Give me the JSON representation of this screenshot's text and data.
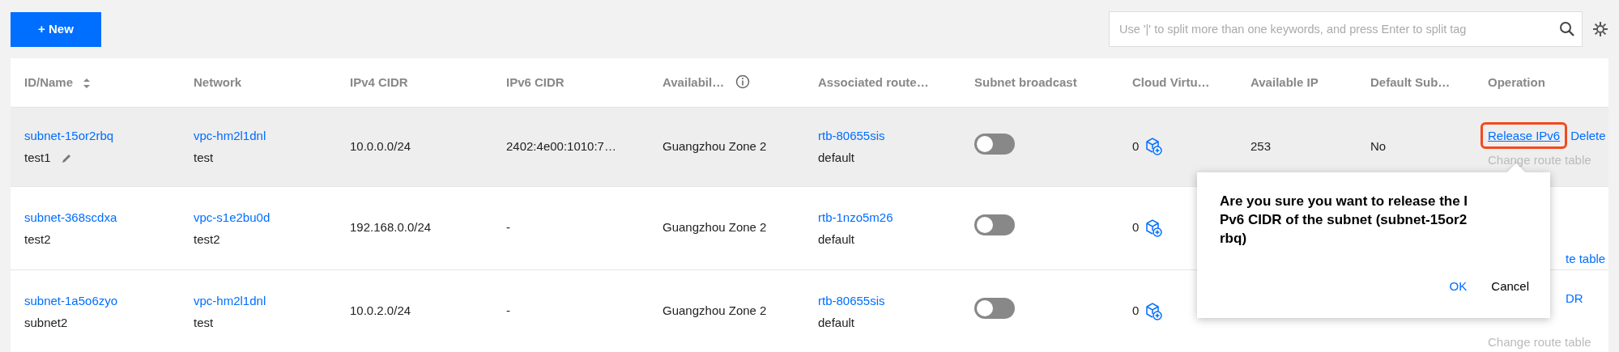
{
  "toolbar": {
    "new_button": "+ New",
    "search": {
      "placeholder": "Use '|' to split more than one keywords, and press Enter to split tag"
    }
  },
  "table": {
    "columns": [
      {
        "label": "ID/Name",
        "sortable": true,
        "info": false
      },
      {
        "label": "Network",
        "sortable": false,
        "info": false
      },
      {
        "label": "IPv4 CIDR",
        "sortable": false,
        "info": false
      },
      {
        "label": "IPv6 CIDR",
        "sortable": false,
        "info": false
      },
      {
        "label": "Availabil…",
        "sortable": false,
        "info": true
      },
      {
        "label": "Associated route…",
        "sortable": false,
        "info": false
      },
      {
        "label": "Subnet broadcast",
        "sortable": false,
        "info": false
      },
      {
        "label": "Cloud Virtu…",
        "sortable": false,
        "info": false
      },
      {
        "label": "Available IP",
        "sortable": false,
        "info": false
      },
      {
        "label": "Default Sub…",
        "sortable": false,
        "info": false
      },
      {
        "label": "Operation",
        "sortable": false,
        "info": false
      }
    ],
    "rows": [
      {
        "selected": true,
        "id": "subnet-15or2rbq",
        "name": "test1",
        "editable": true,
        "network_id": "vpc-hm2l1dnl",
        "network_name": "test",
        "ipv4": "10.0.0.0/24",
        "ipv6": "2402:4e00:1010:7…",
        "zone": "Guangzhou Zone 2",
        "route_table": "rtb-80655sis",
        "route_name": "default",
        "broadcast": false,
        "cvm_count": "0",
        "available_ip": "253",
        "default_subnet": "No",
        "operations": [
          [
            {
              "label": "Release IPv6",
              "kind": "link",
              "highlighted": true
            },
            {
              "label": "Delete",
              "kind": "link",
              "highlighted": false
            }
          ],
          [
            {
              "label": "Change route table",
              "kind": "disabled",
              "highlighted": false
            }
          ]
        ]
      },
      {
        "selected": false,
        "id": "subnet-368scdxa",
        "name": "test2",
        "editable": false,
        "network_id": "vpc-s1e2bu0d",
        "network_name": "test2",
        "ipv4": "192.168.0.0/24",
        "ipv6": "-",
        "zone": "Guangzhou Zone 2",
        "route_table": "rtb-1nzo5m26",
        "route_name": "default",
        "broadcast": false,
        "cvm_count": "0",
        "operations": [
          [
            {
              "kind": "covered"
            }
          ],
          [
            {
              "kind": "covered"
            }
          ],
          [
            {
              "label": "te table",
              "kind": "partial",
              "highlighted": false
            }
          ]
        ]
      },
      {
        "selected": false,
        "id": "subnet-1a5o6zyo",
        "name": "subnet2",
        "editable": false,
        "network_id": "vpc-hm2l1dnl",
        "network_name": "test",
        "ipv4": "10.0.2.0/24",
        "ipv6": "-",
        "zone": "Guangzhou Zone 2",
        "route_table": "rtb-80655sis",
        "route_name": "default",
        "broadcast": false,
        "cvm_count": "0",
        "operations": [
          [
            {
              "label": "DR",
              "kind": "partial",
              "highlighted": false
            }
          ],
          [
            {
              "kind": "covered"
            }
          ],
          [
            {
              "label": "Change route table",
              "kind": "disabled",
              "highlighted": false
            }
          ]
        ]
      }
    ]
  },
  "popconfirm": {
    "message": "Are you sure you want to release the IPv6 CIDR of the subnet (subnet-15or2rbq)",
    "ok": "OK",
    "cancel": "Cancel"
  }
}
